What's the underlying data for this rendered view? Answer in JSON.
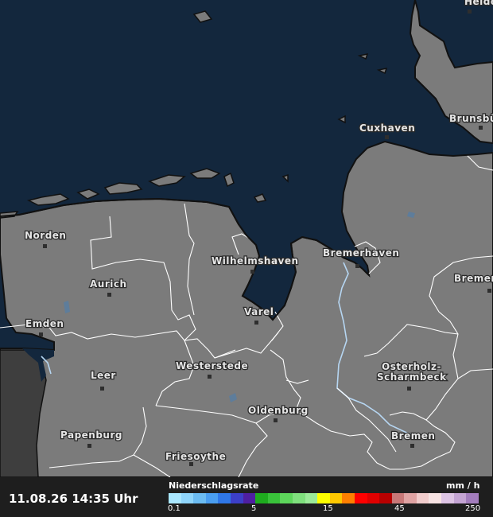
{
  "cities": [
    {
      "name": "Heide",
      "label": "Heide"
    },
    {
      "name": "Cuxhaven",
      "label": "Cuxhaven"
    },
    {
      "name": "Brunsbuettel",
      "label": "Brunsbü"
    },
    {
      "name": "Norden",
      "label": "Norden"
    },
    {
      "name": "Wilhelmshaven",
      "label": "Wilhelmshaven"
    },
    {
      "name": "Bremerhaven",
      "label": "Bremerhaven"
    },
    {
      "name": "Bremervoerde",
      "label": "Bremer"
    },
    {
      "name": "Aurich",
      "label": "Aurich"
    },
    {
      "name": "Varel",
      "label": "Varel"
    },
    {
      "name": "Emden",
      "label": "Emden"
    },
    {
      "name": "Leer",
      "label": "Leer"
    },
    {
      "name": "Westerstede",
      "label": "Westerstede"
    },
    {
      "name": "Osterholz-Scharmbeck",
      "label_line1": "Osterholz-",
      "label_line2": "Scharmbeck"
    },
    {
      "name": "Oldenburg",
      "label": "Oldenburg"
    },
    {
      "name": "Papenburg",
      "label": "Papenburg"
    },
    {
      "name": "Bremen",
      "label": "Bremen"
    },
    {
      "name": "Friesoythe",
      "label": "Friesoythe"
    }
  ],
  "footer": {
    "timestamp": "11.08.26 14:35 Uhr",
    "legend_title": "Niederschlagsrate",
    "legend_unit": "mm / h",
    "legend_ticks": [
      "0.1",
      "5",
      "15",
      "45",
      "250"
    ],
    "legend_colors": [
      "#a9e7ff",
      "#8fd5fb",
      "#6cbcf2",
      "#4a9ef0",
      "#2f77e8",
      "#3c3fc8",
      "#4f1fa2",
      "#1eab1e",
      "#39c23a",
      "#5dd65b",
      "#7fe07d",
      "#9cea99",
      "#ffff00",
      "#ffc800",
      "#ff7f00",
      "#ff0000",
      "#e00000",
      "#b80000",
      "#c87878",
      "#e0a3a3",
      "#f1cccc",
      "#f7e3e3",
      "#ddc4e4",
      "#c4a4d3",
      "#a37dbd"
    ]
  },
  "colors": {
    "sea": "#13273d",
    "land": "#7b7b7b",
    "coast": "#111111",
    "border": "#ffffff",
    "river": "#b6d6f2"
  }
}
